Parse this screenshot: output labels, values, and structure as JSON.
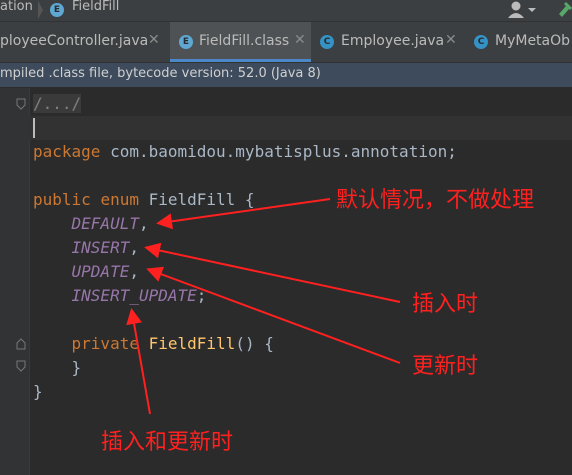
{
  "breadcrumb": {
    "items": [
      "ation",
      "FieldFill"
    ],
    "class_icon_letter": "E"
  },
  "tabs": [
    {
      "label": "ployeeController.java",
      "icon": "",
      "active": false
    },
    {
      "label": "FieldFill.class",
      "icon": "E",
      "active": true
    },
    {
      "label": "Employee.java",
      "icon": "C",
      "active": false
    },
    {
      "label": "MyMetaOb",
      "icon": "C",
      "active": false
    }
  ],
  "info_bar": {
    "text": "mpiled .class file, bytecode version: 52.0 (Java 8)"
  },
  "code": {
    "fold": "/.../",
    "package_kw": "package",
    "package_name": " com.baomidou.mybatisplus.annotation;",
    "public_kw": "public",
    "enum_kw": "enum",
    "class_name": " FieldFill {",
    "constants": [
      "DEFAULT",
      "INSERT",
      "UPDATE",
      "INSERT_UPDATE"
    ],
    "comma": ",",
    "semicolon": ";",
    "private_kw": "private",
    "ctor_name": "FieldFill",
    "ctor_rest": "() {",
    "close_brace": "}",
    "close_brace_outer": "}"
  },
  "annotations": {
    "default_note": "默认情况，不做处理",
    "insert_note": "插入时",
    "update_note": "更新时",
    "insert_update_note": "插入和更新时"
  },
  "colors": {
    "annotation": "#ff2020",
    "keyword": "#cc7832",
    "constant": "#9876aa",
    "method": "#ffc66d",
    "tab_underline": "#4a88c7"
  },
  "icons": [
    "class-enum-icon",
    "class-c-icon",
    "close-icon",
    "user-icon",
    "hammer-icon",
    "fold-icon"
  ]
}
